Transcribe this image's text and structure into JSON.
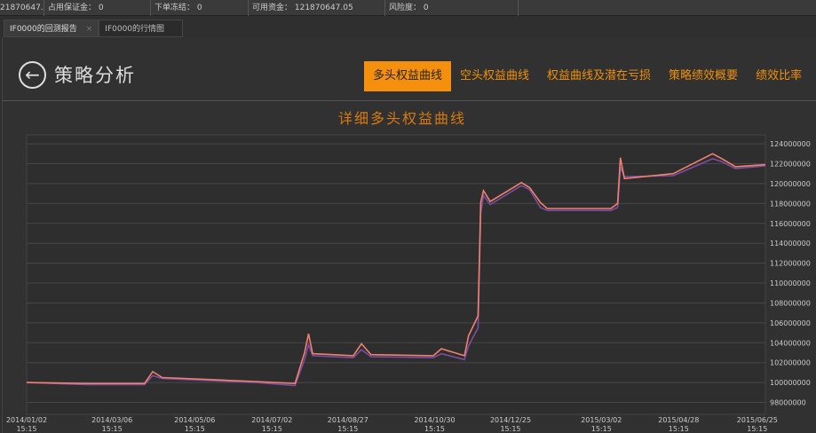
{
  "topbar": {
    "items": [
      "21870647.",
      "占用保证金： 0",
      "下单冻结： 0",
      "可用资金： 121870647.05",
      "风险度： 0"
    ]
  },
  "tabs": [
    {
      "label": "IF0000的回测报告",
      "active": true
    },
    {
      "label": "IF0000的行情图",
      "active": false
    }
  ],
  "header": {
    "title": "策略分析",
    "back_icon": "arrow-left-circle-icon"
  },
  "nav": [
    {
      "label": "多头权益曲线",
      "active": true
    },
    {
      "label": "空头权益曲线"
    },
    {
      "label": "权益曲线及潜在亏损"
    },
    {
      "label": "策略绩效概要"
    },
    {
      "label": "绩效比率"
    }
  ],
  "colors": {
    "accent": "#f5900e",
    "series1": "#f08070",
    "series2": "#7a4fa0"
  },
  "chart_data": {
    "type": "line",
    "title": "详细多头权益曲线",
    "xlim": [
      "2014-01-02",
      "2015-07-01"
    ],
    "ylim": [
      96800000,
      124900000
    ],
    "grid": true,
    "x_ticks": [
      "2014/01/02\n15:15",
      "2014/03/06\n15:15",
      "2014/05/06\n15:15",
      "2014/07/02\n15:15",
      "2014/08/27\n15:15",
      "2014/10/30\n15:15",
      "2014/12/25\n15:15",
      "2015/03/02\n15:15",
      "2015/04/28\n15:15",
      "2015/06/25\n15:15"
    ],
    "y_ticks": [
      98000000,
      100000000,
      102000000,
      104000000,
      106000000,
      108000000,
      110000000,
      112000000,
      114000000,
      116000000,
      118000000,
      120000000,
      122000000,
      124000000
    ],
    "series": [
      {
        "x": [
          "2014-01-02",
          "2014-02-14",
          "2014-03-30",
          "2014-04-05",
          "2014-04-12",
          "2014-06-20",
          "2014-07-19",
          "2014-07-26",
          "2014-07-29",
          "2014-08-01",
          "2014-08-31",
          "2014-09-06",
          "2014-09-13",
          "2014-10-29",
          "2014-11-04",
          "2014-11-21",
          "2014-11-24",
          "2014-12-01",
          "2014-12-03",
          "2014-12-05",
          "2014-12-10",
          "2015-01-02",
          "2015-01-08",
          "2015-01-16",
          "2015-01-21",
          "2015-03-09",
          "2015-03-14",
          "2015-03-16",
          "2015-03-19",
          "2015-04-24",
          "2015-05-23",
          "2015-05-30",
          "2015-06-09",
          "2015-07-01"
        ],
        "values": [
          100000000,
          99900000,
          99900000,
          101100000,
          100500000,
          100100000,
          99900000,
          103000000,
          104900000,
          102900000,
          102700000,
          103900000,
          102800000,
          102700000,
          103400000,
          102700000,
          104700000,
          106700000,
          118100000,
          119300000,
          118200000,
          120100000,
          119600000,
          118100000,
          117500000,
          117500000,
          118000000,
          122600000,
          120500000,
          121000000,
          123000000,
          122500000,
          121700000,
          121900000
        ]
      },
      {
        "x": [
          "2014-01-02",
          "2014-02-14",
          "2014-03-30",
          "2014-04-05",
          "2014-04-12",
          "2014-06-20",
          "2014-07-19",
          "2014-07-26",
          "2014-07-29",
          "2014-08-01",
          "2014-08-31",
          "2014-09-06",
          "2014-09-13",
          "2014-10-29",
          "2014-11-04",
          "2014-11-21",
          "2014-11-24",
          "2014-12-01",
          "2014-12-03",
          "2014-12-05",
          "2014-12-10",
          "2015-01-02",
          "2015-01-08",
          "2015-01-16",
          "2015-01-21",
          "2015-03-09",
          "2015-03-14",
          "2015-03-16",
          "2015-03-19",
          "2015-04-24",
          "2015-05-23",
          "2015-05-30",
          "2015-06-09",
          "2015-07-01"
        ],
        "values": [
          100000000,
          99800000,
          99800000,
          100700000,
          100400000,
          100000000,
          99700000,
          102300000,
          103800000,
          102700000,
          102500000,
          103300000,
          102600000,
          102500000,
          102900000,
          102300000,
          103700000,
          105500000,
          117000000,
          118800000,
          117900000,
          119800000,
          119400000,
          117600000,
          117300000,
          117300000,
          117600000,
          121700000,
          120700000,
          120800000,
          122500000,
          122200000,
          121500000,
          121800000
        ]
      }
    ]
  }
}
